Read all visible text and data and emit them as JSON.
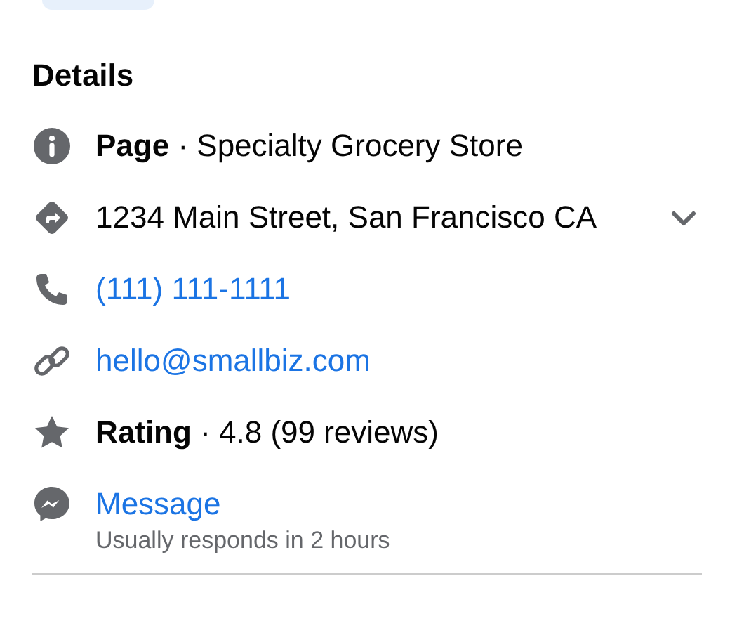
{
  "section_title": "Details",
  "rows": [
    {
      "kind": "text",
      "text": "**Page** · Specialty Grocery Store",
      "expandable": false
    },
    {
      "kind": "text",
      "text": "1234 Main Street, San Francisco CA",
      "expandable": true
    },
    {
      "kind": "link",
      "text": "(111) 111-1111",
      "expandable": false
    },
    {
      "kind": "link",
      "text": "hello@smallbiz.com",
      "expandable": false
    },
    {
      "kind": "text",
      "text": "**Rating** · 4.8 (99 reviews)",
      "expandable": false
    },
    {
      "kind": "link",
      "text": "Message",
      "subtext": "Usually responds in 2 hours",
      "expandable": false
    }
  ]
}
